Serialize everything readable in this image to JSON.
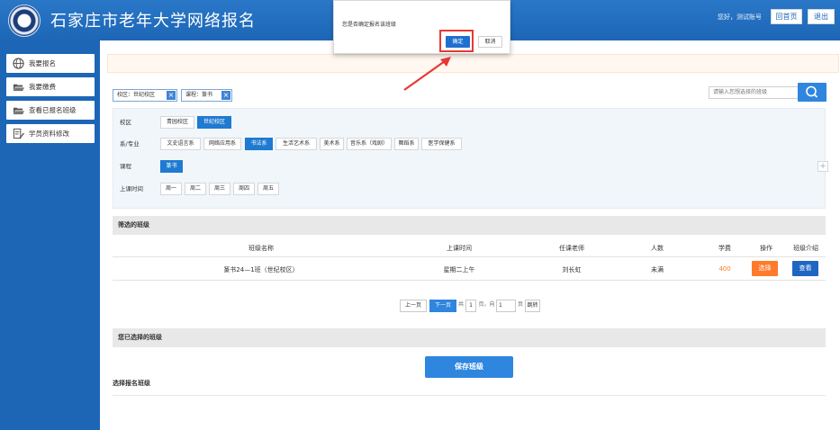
{
  "header": {
    "title": "石家庄市老年大学网络报名",
    "greeting": "您好，测试账号",
    "home_label": "回首页",
    "logout_label": "退出",
    "accent": "#1d66b6"
  },
  "sidebar": {
    "items": [
      {
        "label": "我要报名",
        "icon": "globe-icon"
      },
      {
        "label": "我要缴费",
        "icon": "folder-open-icon"
      },
      {
        "label": "查看已报名班级",
        "icon": "folder-open-icon"
      },
      {
        "label": "学员资料修改",
        "icon": "edit-document-icon"
      }
    ]
  },
  "filters": {
    "tags": [
      {
        "label": "校区：世纪校区"
      },
      {
        "label": "课程：篆书"
      }
    ],
    "search": {
      "placeholder": "请输入您想选择的班级"
    },
    "groups": {
      "campus": {
        "label": "校区",
        "options": [
          "青园校区",
          "世纪校区"
        ],
        "selected": "世纪校区"
      },
      "department": {
        "label": "系/专业",
        "options": [
          "文史语言系",
          "网络应用系",
          "书法系",
          "生活艺术系",
          "美术系",
          "音乐系（戏剧）",
          "舞蹈系",
          "医学保健系"
        ],
        "selected": "书法系"
      },
      "course": {
        "label": "课程",
        "options": [
          "篆书"
        ],
        "selected": "篆书"
      },
      "time": {
        "label": "上课时间",
        "options": [
          "周一",
          "周二",
          "周三",
          "周四",
          "周五"
        ]
      }
    }
  },
  "results": {
    "section_title": "筛选的班级",
    "columns": [
      "班级名称",
      "上课时间",
      "任课老师",
      "人数",
      "学费",
      "操作",
      "班级介绍"
    ],
    "rows": [
      {
        "name": "篆书24—1班（世纪校区）",
        "time": "星期二上午",
        "teacher": "刘长虹",
        "count": "未满",
        "fee": "400",
        "action": "选择",
        "intro": "查看"
      }
    ]
  },
  "pagination": {
    "prev": "上一页",
    "next": "下一页",
    "total_prefix": "共",
    "total_pages": "1",
    "total_suffix": "页，向",
    "goto_value": "1",
    "goto_suffix": "页",
    "jump": "跳转"
  },
  "selected": {
    "section_title": "您已选择的班级",
    "save_label": "保存班级",
    "choose_title": "选择报名班级"
  },
  "dialog": {
    "message": "您是否确定报名该班级",
    "ok_label": "确定",
    "cancel_label": "取消"
  }
}
